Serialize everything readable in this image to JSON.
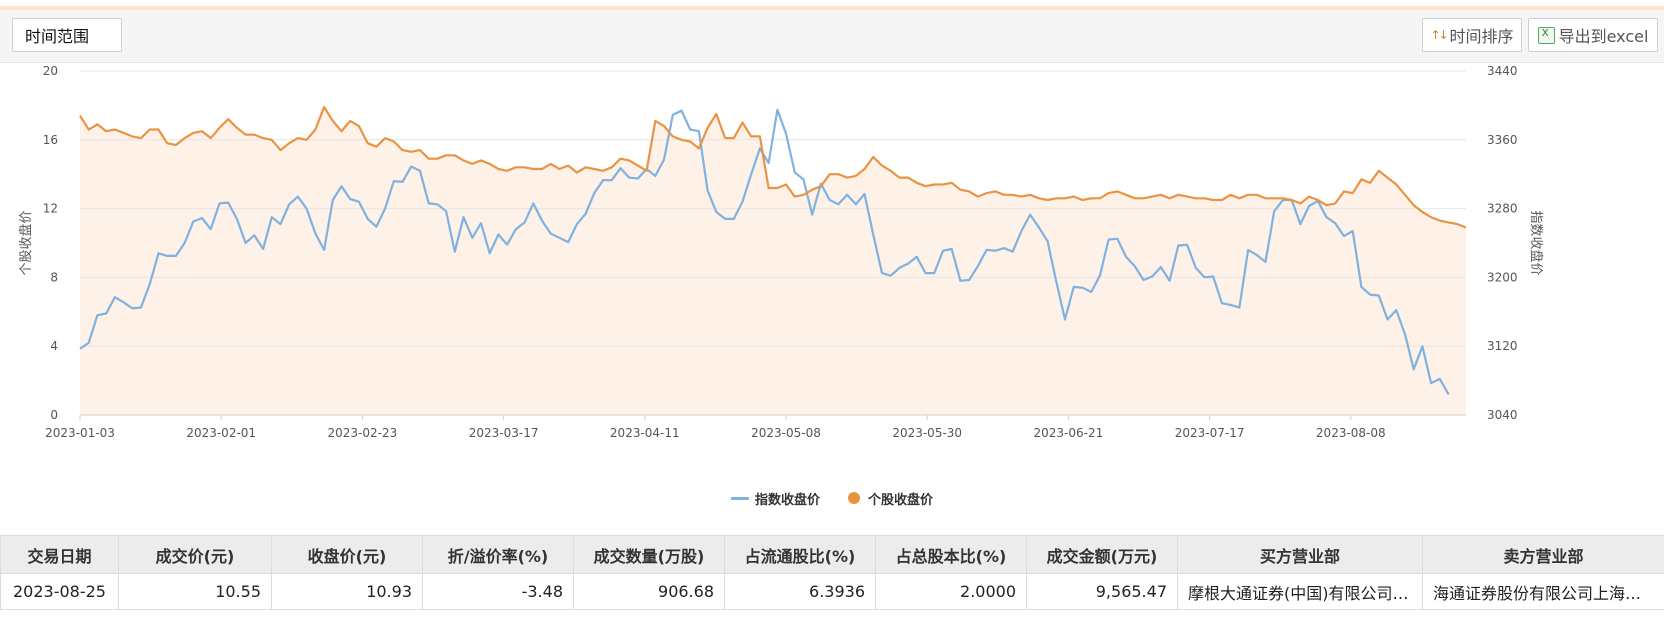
{
  "toolbar": {
    "time_range_label": "时间范围",
    "sort_label": "时间排序",
    "export_label": "导出到excel",
    "sort_icon": "sort-arrows-icon",
    "export_icon": "excel-icon"
  },
  "colors": {
    "index_line": "#7fb2e0",
    "stock_line": "#ea9343",
    "area_fill": "#fdf1e8",
    "accent": "#f8d3b6"
  },
  "chart_data": {
    "type": "line",
    "ylabel_left": "个股收盘价",
    "ylabel_right": "指数收盘价",
    "ylim_left": [
      0,
      20
    ],
    "ylim_right": [
      3040,
      3440
    ],
    "yticks_left": [
      "0",
      "4",
      "8",
      "12",
      "16",
      "20"
    ],
    "yticks_right": [
      "3040",
      "3120",
      "3200",
      "3280",
      "3360",
      "3440"
    ],
    "xticks": [
      "2023-01-03",
      "2023-02-01",
      "2023-02-23",
      "2023-03-17",
      "2023-04-11",
      "2023-05-08",
      "2023-05-30",
      "2023-06-21",
      "2023-07-17",
      "2023-08-08"
    ],
    "grid": true,
    "legend_position": "bottom-center",
    "series": [
      {
        "name": "指数收盘价",
        "axis": "right",
        "values": [
          3117,
          3124,
          3156,
          3158,
          3177,
          3171,
          3164,
          3165,
          3192,
          3228,
          3225,
          3225,
          3240,
          3265,
          3269,
          3256,
          3286,
          3287,
          3268,
          3240,
          3249,
          3233,
          3270,
          3262,
          3285,
          3294,
          3280,
          3251,
          3232,
          3290,
          3306,
          3291,
          3288,
          3268,
          3259,
          3280,
          3312,
          3311,
          3329,
          3324,
          3286,
          3285,
          3277,
          3230,
          3270,
          3246,
          3263,
          3228,
          3250,
          3238,
          3256,
          3264,
          3286,
          3266,
          3251,
          3246,
          3241,
          3262,
          3274,
          3298,
          3313,
          3313,
          3327,
          3316,
          3315,
          3326,
          3318,
          3337,
          3389,
          3394,
          3372,
          3370,
          3301,
          3276,
          3268,
          3268,
          3288,
          3320,
          3350,
          3333,
          3395,
          3367,
          3322,
          3314,
          3273,
          3309,
          3290,
          3285,
          3296,
          3285,
          3297,
          3250,
          3205,
          3202,
          3211,
          3216,
          3224,
          3205,
          3205,
          3231,
          3233,
          3196,
          3197,
          3213,
          3232,
          3231,
          3234,
          3230,
          3254,
          3273,
          3258,
          3242,
          3195,
          3151,
          3189,
          3188,
          3183,
          3202,
          3244,
          3245,
          3224,
          3213,
          3197,
          3201,
          3212,
          3196,
          3237,
          3238,
          3211,
          3200,
          3201,
          3170,
          3168,
          3165,
          3232,
          3226,
          3218,
          3277,
          3290,
          3290,
          3262,
          3283,
          3289,
          3270,
          3263,
          3248,
          3254,
          3189,
          3180,
          3179,
          3151,
          3162,
          3134,
          3093,
          3120,
          3077,
          3082,
          3064
        ]
      },
      {
        "name": "个股收盘价",
        "axis": "left",
        "values": [
          17.4,
          16.6,
          16.9,
          16.5,
          16.6,
          16.4,
          16.2,
          16.1,
          16.6,
          16.6,
          15.8,
          15.7,
          16.1,
          16.4,
          16.5,
          16.1,
          16.7,
          17.2,
          16.7,
          16.3,
          16.3,
          16.1,
          16.0,
          15.4,
          15.8,
          16.1,
          16.0,
          16.6,
          17.9,
          17.1,
          16.5,
          17.1,
          16.8,
          15.8,
          15.6,
          16.1,
          15.9,
          15.4,
          15.3,
          15.4,
          14.9,
          14.9,
          15.1,
          15.1,
          14.8,
          14.6,
          14.8,
          14.6,
          14.3,
          14.2,
          14.4,
          14.4,
          14.3,
          14.3,
          14.6,
          14.3,
          14.5,
          14.1,
          14.4,
          14.3,
          14.2,
          14.4,
          14.9,
          14.8,
          14.5,
          14.2,
          17.1,
          16.8,
          16.2,
          16.0,
          15.9,
          15.5,
          16.7,
          17.5,
          16.1,
          16.1,
          17.0,
          16.2,
          16.2,
          13.2,
          13.2,
          13.4,
          12.7,
          12.8,
          13.1,
          13.3,
          14.0,
          14.0,
          13.8,
          13.9,
          14.3,
          15.0,
          14.5,
          14.2,
          13.8,
          13.8,
          13.5,
          13.3,
          13.4,
          13.4,
          13.5,
          13.1,
          13.0,
          12.7,
          12.9,
          13.0,
          12.8,
          12.8,
          12.7,
          12.8,
          12.6,
          12.5,
          12.6,
          12.6,
          12.7,
          12.5,
          12.6,
          12.6,
          12.9,
          13.0,
          12.8,
          12.6,
          12.6,
          12.7,
          12.8,
          12.6,
          12.8,
          12.7,
          12.6,
          12.6,
          12.5,
          12.5,
          12.8,
          12.6,
          12.8,
          12.8,
          12.6,
          12.6,
          12.6,
          12.5,
          12.3,
          12.7,
          12.5,
          12.2,
          12.3,
          13.0,
          12.9,
          13.7,
          13.5,
          14.2,
          13.8,
          13.4,
          12.8,
          12.2,
          11.8,
          11.5,
          11.3,
          11.2,
          11.1,
          10.9
        ]
      }
    ]
  },
  "table": {
    "headers": [
      "交易日期",
      "成交价(元)",
      "收盘价(元)",
      "折/溢价率(%)",
      "成交数量(万股)",
      "占流通股比(%)",
      "占总股本比(%)",
      "成交金额(万元)",
      "买方营业部",
      "卖方营业部"
    ],
    "rows": [
      [
        "2023-08-25",
        "10.55",
        "10.93",
        "-3.48",
        "906.68",
        "6.3936",
        "2.0000",
        "9,565.47",
        "摩根大通证券(中国)有限公司…",
        "海通证券股份有限公司上海…"
      ]
    ]
  }
}
